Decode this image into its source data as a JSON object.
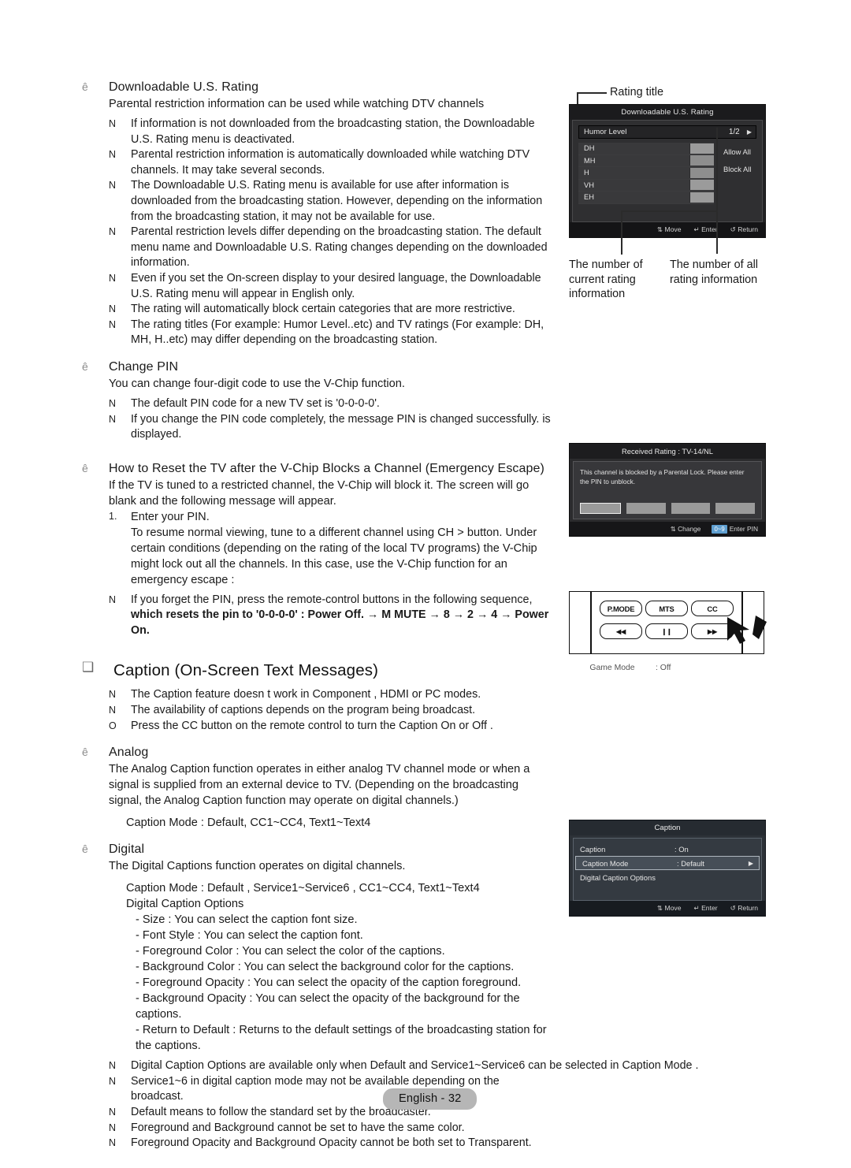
{
  "page": {
    "footer_label": "English - 32"
  },
  "left_column": {
    "section_downloadable": {
      "heading": "Downloadable U.S. Rating",
      "intro": "Parental restriction information can be used while watching DTV channels",
      "notes": [
        "If information is not downloaded from the broadcasting station, the Downloadable U.S. Rating  menu is deactivated.",
        "Parental restriction information is automatically downloaded while watching DTV channels. It may take several seconds.",
        "The Downloadable U.S. Rating   menu is available for use after information is downloaded from the broadcasting station. However, depending on the information from the broadcasting station, it may not be available for use.",
        "Parental restriction levels differ depending on the broadcasting station. The default menu name and Downloadable U.S. Rating   changes depending on the downloaded information.",
        "Even if you set the On-screen display to your desired language, the Downloadable U.S. Rating  menu will appear in English only.",
        "The rating will automatically block certain categories that are more restrictive.",
        "The rating titles (For example: Humor Level..etc) and TV ratings (For example: DH, MH, H..etc) may differ depending on the broadcasting station."
      ]
    },
    "section_change_pin": {
      "heading": "Change  PIN",
      "intro": "You can change four-digit code to use the V-Chip function.",
      "notes": [
        "The default PIN code for a new TV set is '0-0-0-0'.",
        "If you change the PIN code completely, the message PIN is changed successfully.    is displayed."
      ]
    },
    "section_reset": {
      "heading": "How to Reset the TV after the V-Chip Blocks a Channel (Emergency Escape)",
      "intro": "If the TV is tuned to a restricted channel, the V-Chip will block it. The screen will go blank and the following message will appear.",
      "step_number": "1.",
      "step_title": "Enter your PIN.",
      "step_body": "To resume normal viewing, tune to a different channel using CH >   button. Under certain conditions (depending on the rating of the local TV programs) the V-Chip might lock out all the channels. In this case, use the V-Chip function for an  emergency escape :",
      "note_line1": "If you forget the PIN, press the remote-control buttons in the following sequence,",
      "note_line2_bold": "which resets the pin to '0-0-0-0' : Power Off. → M MUTE → 8 → 2 → 4 → Power On."
    },
    "section_caption": {
      "heading": "Caption (On-Screen Text Messages)",
      "notes": [
        "The Caption feature doesn t work in Component , HDMI or PC modes.",
        "The availability of captions depends on the program being broadcast.",
        "Press the CC button on the remote control to turn the Caption On  or Off ."
      ],
      "note_marks": [
        "N",
        "N",
        "O"
      ]
    },
    "section_analog": {
      "heading": "Analog",
      "body": "The Analog Caption function operates in either analog TV channel mode or when a signal is supplied from an external device to TV. (Depending on the broadcasting signal, the Analog Caption function may operate on digital channels.)",
      "caption_mode": "Caption Mode  : Default, CC1~CC4, Text1~Text4"
    },
    "section_digital": {
      "heading": "Digital",
      "body": "The Digital Captions function operates on digital channels.",
      "caption_mode": "Caption Mode  : Default , Service1~Service6 , CC1~CC4, Text1~Text4",
      "options_title": "Digital Caption Options",
      "options": [
        "- Size : You can select the caption font size.",
        "- Font Style :  You can select the caption font.",
        "- Foreground Color   : You can select the color of the captions.",
        "- Background Color   : You can select the background color for the captions.",
        "- Foreground Opacity   : You can select the opacity of the caption foreground.",
        "- Background Opacity   : You can select the opacity of the background for the captions.",
        "- Return to Default  : Returns to the default settings of the broadcasting station for the captions."
      ],
      "final_notes": [
        "Digital Caption Options   are available only when Default  and Service1~Service6   can be selected in Caption Mode .",
        "Service1~6  in digital caption mode may not be available depending on the broadcast.",
        "Default  means to follow the standard set by the broadcaster.",
        "Foreground and Background cannot be set to have the same color.",
        "Foreground Opacity and Background Opacity cannot be both set to Transparent."
      ]
    }
  },
  "right_column": {
    "rating_callout_top": "Rating title",
    "rating_osd": {
      "title": "Downloadable U.S. Rating",
      "selected_item": "Humor Level",
      "page_indicator": "1/2",
      "rows": [
        "DH",
        "MH",
        "H",
        "VH",
        "EH"
      ],
      "side_buttons": [
        "Allow All",
        "Block All"
      ],
      "footer": [
        "Move",
        "Enter",
        "Return"
      ]
    },
    "callout_left": "The number of current rating information",
    "callout_right": "The number of all rating information",
    "blocked_osd": {
      "title": "Received Rating : TV-14/NL",
      "message": "This channel is blocked by a Parental Lock. Please enter the PIN to unblock.",
      "footer_change": "Change",
      "footer_key": "0~9",
      "footer_enter": "Enter  PIN"
    },
    "remote": {
      "buttons_top": [
        "P.MODE",
        "MTS",
        "CC"
      ],
      "buttons_bottom": [
        "◀◀",
        "❙❙",
        "▶▶"
      ],
      "game_mode_key": "Game Mode",
      "game_mode_value": ": Off"
    },
    "caption_osd": {
      "title": "Caption",
      "rows": [
        {
          "key": "Caption",
          "value": ": On"
        },
        {
          "key": "Caption Mode",
          "value": ": Default"
        },
        {
          "key": "Digital Caption Options",
          "value": ""
        }
      ],
      "footer": [
        "Move",
        "Enter",
        "Return"
      ]
    }
  }
}
